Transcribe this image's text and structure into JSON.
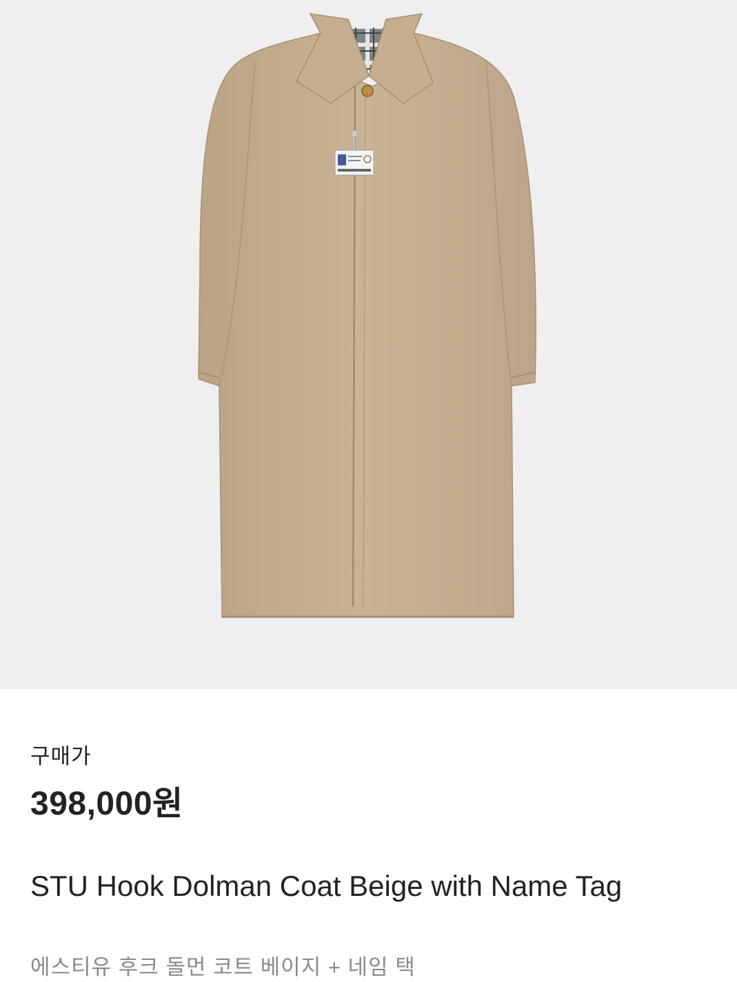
{
  "product": {
    "image_icon": "beige-coat-photo",
    "price_label": "구매가",
    "price": "398,000원",
    "name_en": "STU Hook Dolman Coat Beige with Name Tag",
    "name_kr": "에스티유 후크 돌먼 코트 베이지 + 네임 택"
  },
  "colors": {
    "image_background": "#efeef1",
    "coat": "#c6b093",
    "text_primary": "#222222",
    "text_secondary": "#8a8a8a"
  }
}
